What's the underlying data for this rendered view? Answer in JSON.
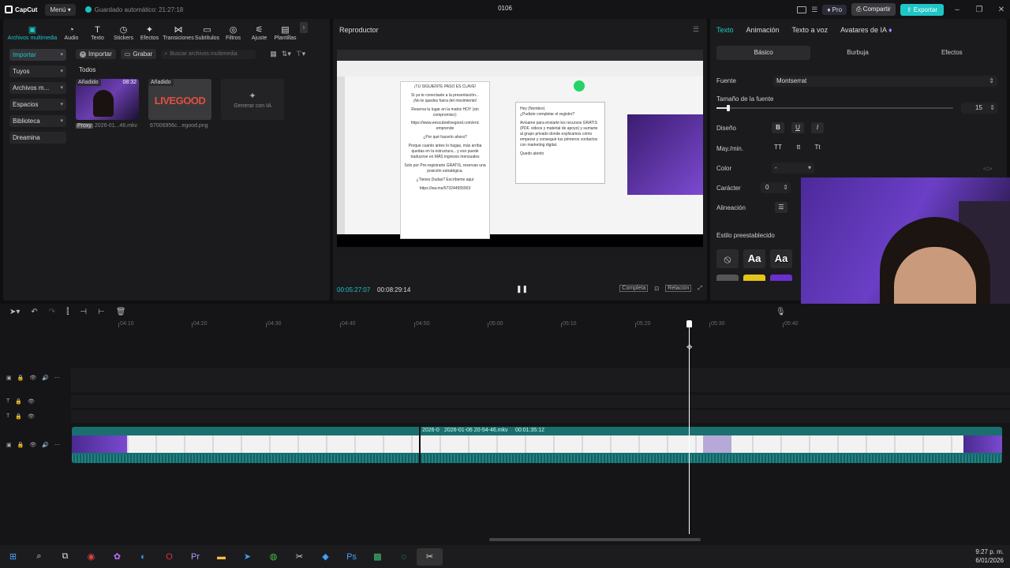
{
  "titlebar": {
    "app_name": "CapCut",
    "menu_label": "Menú",
    "autosave_text": "Guardado automático: 21:27:18",
    "project_title": "0106",
    "pro_label": "Pro",
    "share_label": "Compartir",
    "export_label": "Exportar"
  },
  "media_tools": [
    {
      "label": "Archivos multimedia",
      "icon": "media-icon"
    },
    {
      "label": "Audio",
      "icon": "audio-icon"
    },
    {
      "label": "Texto",
      "icon": "text-icon"
    },
    {
      "label": "Stickers",
      "icon": "sticker-icon"
    },
    {
      "label": "Efectos",
      "icon": "effects-icon"
    },
    {
      "label": "Transiciones",
      "icon": "transitions-icon"
    },
    {
      "label": "Subtítulos",
      "icon": "subtitles-icon"
    },
    {
      "label": "Filtros",
      "icon": "filters-icon"
    },
    {
      "label": "Ajuste",
      "icon": "adjust-icon"
    },
    {
      "label": "Plantillas",
      "icon": "templates-icon"
    }
  ],
  "side_nav": [
    {
      "label": "Importar"
    },
    {
      "label": "Tuyos"
    },
    {
      "label": "Archivos m..."
    },
    {
      "label": "Espacios"
    },
    {
      "label": "Biblioteca"
    },
    {
      "label": "Dreamina"
    }
  ],
  "media": {
    "import_label": "Importar",
    "record_label": "Grabar",
    "search_placeholder": "Buscar archivos multimedia",
    "section_label": "Todos",
    "clips": [
      {
        "tag": "Añadido",
        "duration": "08:32",
        "proxy": "Proxy",
        "name": "2026-01...46.mkv"
      },
      {
        "tag": "Añadido",
        "duration": "",
        "name": "67006956c...egood.png",
        "thumb_text": "LIVEGOOD"
      }
    ],
    "gen_ai_label": "Generar con IA"
  },
  "player": {
    "title": "Reproductor",
    "current_time": "00:05:27:07",
    "total_time": "00:08:29:14",
    "full_label": "Completa",
    "ratio_label": "Relación",
    "screen": {
      "col1_lines": [
        "¡TU SIGUIENTE PASO ES CLAVE!",
        "Si ya te conectaste a la presentación...",
        "¡No te quedes fuera del movimiento!",
        "Reserva tu lugar en la matriz HOY (sin compromiso):",
        "https://www.eescubrelivegood.com/eric",
        "emprende",
        "¿Por qué hacerlo ahora?",
        "Porque cuanto antes lo hagas, más arriba quedas en la estructura... y eso puede traducirse en MÁS ingresos mensuales",
        "Solo por Pre-registrarte GRATIS, reservas una posición estratégica.",
        "¿Tienes Dudas? Escríbeme aquí",
        "https://wa.me/573244955903"
      ],
      "col2_lines": [
        "Hey (Nombre)",
        "¿Pudiste completar el registro?",
        "Avísame para enviarte los recursos GRATIS (PDF, videos y material de apoyo) y sumarte al grupo privado donde explicamos cómo empezar y conseguir tus primeros contactos con marketing digital.",
        "Quedo atento"
      ]
    }
  },
  "props": {
    "tabs": [
      "Texto",
      "Animación",
      "Texto a voz",
      "Avatares de IA"
    ],
    "subtabs": [
      "Básico",
      "Burbuja",
      "Efectos"
    ],
    "font_label": "Fuente",
    "font_value": "Montserrat",
    "size_label": "Tamaño de la fuente",
    "size_value": "15",
    "size_level": 0.05,
    "design_label": "Diseño",
    "case_label": "May./min.",
    "case_options": [
      "TT",
      "tt",
      "Tt"
    ],
    "color_label": "Color",
    "color_value": "-",
    "char_label": "Carácter",
    "char_value": "0",
    "align_label": "Alineación",
    "preset_label": "Estilo preestablecido"
  },
  "timeline": {
    "ticks": [
      "04:10",
      "04:20",
      "04:30",
      "04:40",
      "04:50",
      "05:00",
      "05:10",
      "05:20",
      "05:30",
      "05:40"
    ],
    "clip_label_a": "2026-0",
    "clip_label_b": "2026-01-06 20-54-46.mkv",
    "clip_duration": "00:01:35:12"
  },
  "taskbar": {
    "time": "9:27 p. m.",
    "date": "6/01/2026"
  },
  "colors": {
    "accent": "#1fc6c6",
    "clip_teal": "#1a6f6f",
    "panel_bg": "#1b1b1d"
  }
}
